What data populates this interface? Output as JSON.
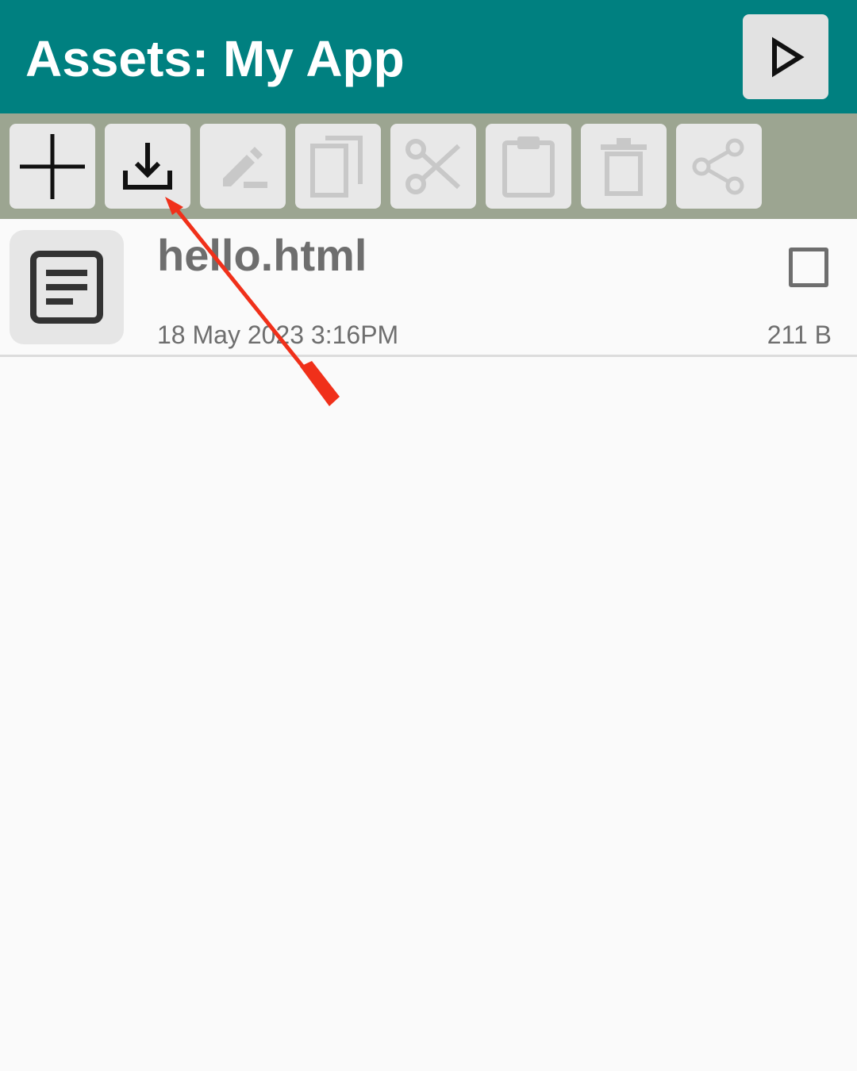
{
  "header": {
    "title": "Assets: My App",
    "run_icon": "play-icon"
  },
  "toolbar": {
    "buttons": [
      {
        "icon": "plus-icon",
        "enabled": true
      },
      {
        "icon": "import-download-icon",
        "enabled": true
      },
      {
        "icon": "rename-edit-icon",
        "enabled": false
      },
      {
        "icon": "copy-icon",
        "enabled": false
      },
      {
        "icon": "cut-scissors-icon",
        "enabled": false
      },
      {
        "icon": "paste-clipboard-icon",
        "enabled": false
      },
      {
        "icon": "delete-trash-icon",
        "enabled": false
      },
      {
        "icon": "share-icon",
        "enabled": false
      }
    ]
  },
  "files": [
    {
      "name": "hello.html",
      "modified": "18 May 2023 3:16PM",
      "size": "211 B",
      "icon": "document-icon",
      "checked": false
    }
  ],
  "colors": {
    "header_bg": "#008080",
    "toolbar_bg": "#9ca591",
    "button_bg": "#e8e8e8",
    "enabled_icon": "#111111",
    "disabled_icon": "#c8c8c8",
    "text_gray": "#6e6e6e",
    "annotation_arrow": "#f0301a"
  }
}
